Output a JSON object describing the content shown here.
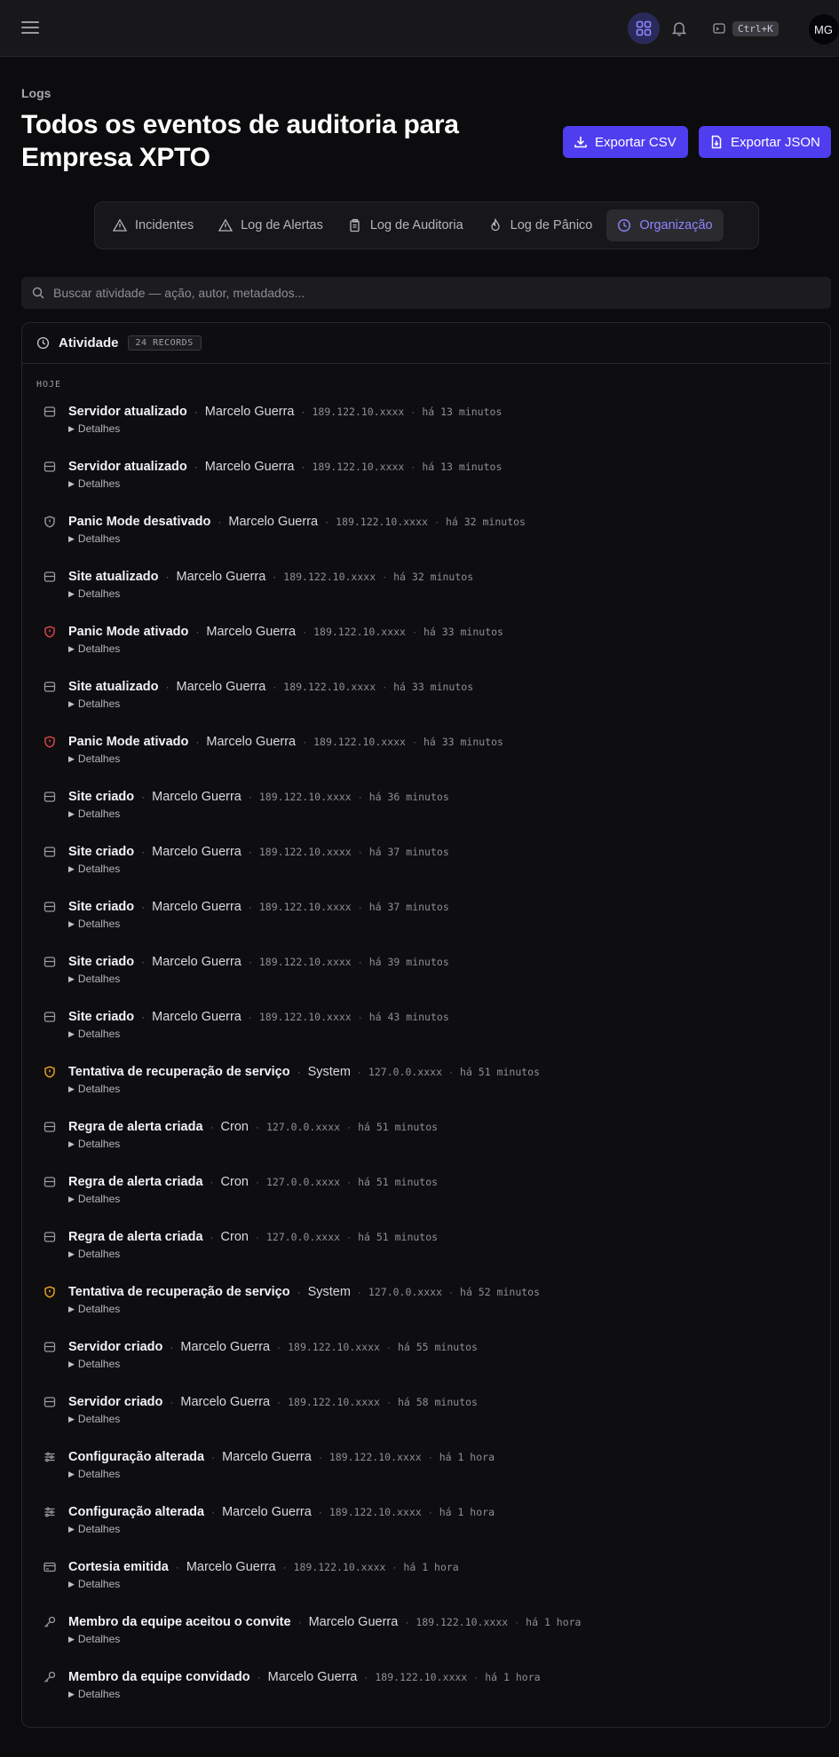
{
  "topbar": {
    "shortcut": "Ctrl+K",
    "avatar_initials": "MG"
  },
  "header": {
    "breadcrumb": "Logs",
    "title": "Todos os eventos de auditoria para Empresa XPTO",
    "export_csv": "Exportar CSV",
    "export_json": "Exportar JSON"
  },
  "tabs": [
    {
      "label": "Incidentes",
      "icon": "warning-icon",
      "active": false
    },
    {
      "label": "Log de Alertas",
      "icon": "warning-icon",
      "active": false
    },
    {
      "label": "Log de Auditoria",
      "icon": "clipboard-icon",
      "active": false
    },
    {
      "label": "Log de Pânico",
      "icon": "flame-icon",
      "active": false
    },
    {
      "label": "Organização",
      "icon": "clock-icon",
      "active": true
    }
  ],
  "search": {
    "placeholder": "Buscar atividade — ação, autor, metadados..."
  },
  "activity": {
    "title": "Atividade",
    "records_badge": "24 RECORDS",
    "section_label": "HOJE",
    "details_label": "Detalhes",
    "events": [
      {
        "action": "Servidor atualizado",
        "actor": "Marcelo Guerra",
        "ip": "189.122.10.xxxx",
        "time": "há 13 minutos",
        "icon": "server-icon",
        "color": "#9a9aa2"
      },
      {
        "action": "Servidor atualizado",
        "actor": "Marcelo Guerra",
        "ip": "189.122.10.xxxx",
        "time": "há 13 minutos",
        "icon": "server-icon",
        "color": "#9a9aa2"
      },
      {
        "action": "Panic Mode desativado",
        "actor": "Marcelo Guerra",
        "ip": "189.122.10.xxxx",
        "time": "há 32 minutos",
        "icon": "shield-icon",
        "color": "#9a9aa2"
      },
      {
        "action": "Site atualizado",
        "actor": "Marcelo Guerra",
        "ip": "189.122.10.xxxx",
        "time": "há 32 minutos",
        "icon": "server-icon",
        "color": "#9a9aa2"
      },
      {
        "action": "Panic Mode ativado",
        "actor": "Marcelo Guerra",
        "ip": "189.122.10.xxxx",
        "time": "há 33 minutos",
        "icon": "shield-icon",
        "color": "#e5484d"
      },
      {
        "action": "Site atualizado",
        "actor": "Marcelo Guerra",
        "ip": "189.122.10.xxxx",
        "time": "há 33 minutos",
        "icon": "server-icon",
        "color": "#9a9aa2"
      },
      {
        "action": "Panic Mode ativado",
        "actor": "Marcelo Guerra",
        "ip": "189.122.10.xxxx",
        "time": "há 33 minutos",
        "icon": "shield-icon",
        "color": "#e5484d"
      },
      {
        "action": "Site criado",
        "actor": "Marcelo Guerra",
        "ip": "189.122.10.xxxx",
        "time": "há 36 minutos",
        "icon": "server-icon",
        "color": "#9a9aa2"
      },
      {
        "action": "Site criado",
        "actor": "Marcelo Guerra",
        "ip": "189.122.10.xxxx",
        "time": "há 37 minutos",
        "icon": "server-icon",
        "color": "#9a9aa2"
      },
      {
        "action": "Site criado",
        "actor": "Marcelo Guerra",
        "ip": "189.122.10.xxxx",
        "time": "há 37 minutos",
        "icon": "server-icon",
        "color": "#9a9aa2"
      },
      {
        "action": "Site criado",
        "actor": "Marcelo Guerra",
        "ip": "189.122.10.xxxx",
        "time": "há 39 minutos",
        "icon": "server-icon",
        "color": "#9a9aa2"
      },
      {
        "action": "Site criado",
        "actor": "Marcelo Guerra",
        "ip": "189.122.10.xxxx",
        "time": "há 43 minutos",
        "icon": "server-icon",
        "color": "#9a9aa2"
      },
      {
        "action": "Tentativa de recuperação de serviço",
        "actor": "System",
        "ip": "127.0.0.xxxx",
        "time": "há 51 minutos",
        "icon": "shield-icon",
        "color": "#f5a524"
      },
      {
        "action": "Regra de alerta criada",
        "actor": "Cron",
        "ip": "127.0.0.xxxx",
        "time": "há 51 minutos",
        "icon": "server-icon",
        "color": "#9a9aa2"
      },
      {
        "action": "Regra de alerta criada",
        "actor": "Cron",
        "ip": "127.0.0.xxxx",
        "time": "há 51 minutos",
        "icon": "server-icon",
        "color": "#9a9aa2"
      },
      {
        "action": "Regra de alerta criada",
        "actor": "Cron",
        "ip": "127.0.0.xxxx",
        "time": "há 51 minutos",
        "icon": "server-icon",
        "color": "#9a9aa2"
      },
      {
        "action": "Tentativa de recuperação de serviço",
        "actor": "System",
        "ip": "127.0.0.xxxx",
        "time": "há 52 minutos",
        "icon": "shield-icon",
        "color": "#f5a524"
      },
      {
        "action": "Servidor criado",
        "actor": "Marcelo Guerra",
        "ip": "189.122.10.xxxx",
        "time": "há 55 minutos",
        "icon": "server-icon",
        "color": "#9a9aa2"
      },
      {
        "action": "Servidor criado",
        "actor": "Marcelo Guerra",
        "ip": "189.122.10.xxxx",
        "time": "há 58 minutos",
        "icon": "server-icon",
        "color": "#9a9aa2"
      },
      {
        "action": "Configuração alterada",
        "actor": "Marcelo Guerra",
        "ip": "189.122.10.xxxx",
        "time": "há 1 hora",
        "icon": "sliders-icon",
        "color": "#9a9aa2"
      },
      {
        "action": "Configuração alterada",
        "actor": "Marcelo Guerra",
        "ip": "189.122.10.xxxx",
        "time": "há 1 hora",
        "icon": "sliders-icon",
        "color": "#9a9aa2"
      },
      {
        "action": "Cortesia emitida",
        "actor": "Marcelo Guerra",
        "ip": "189.122.10.xxxx",
        "time": "há 1 hora",
        "icon": "card-icon",
        "color": "#9a9aa2"
      },
      {
        "action": "Membro da equipe aceitou o convite",
        "actor": "Marcelo Guerra",
        "ip": "189.122.10.xxxx",
        "time": "há 1 hora",
        "icon": "key-icon",
        "color": "#9a9aa2"
      },
      {
        "action": "Membro da equipe convidado",
        "actor": "Marcelo Guerra",
        "ip": "189.122.10.xxxx",
        "time": "há 1 hora",
        "icon": "key-icon",
        "color": "#9a9aa2"
      }
    ]
  }
}
